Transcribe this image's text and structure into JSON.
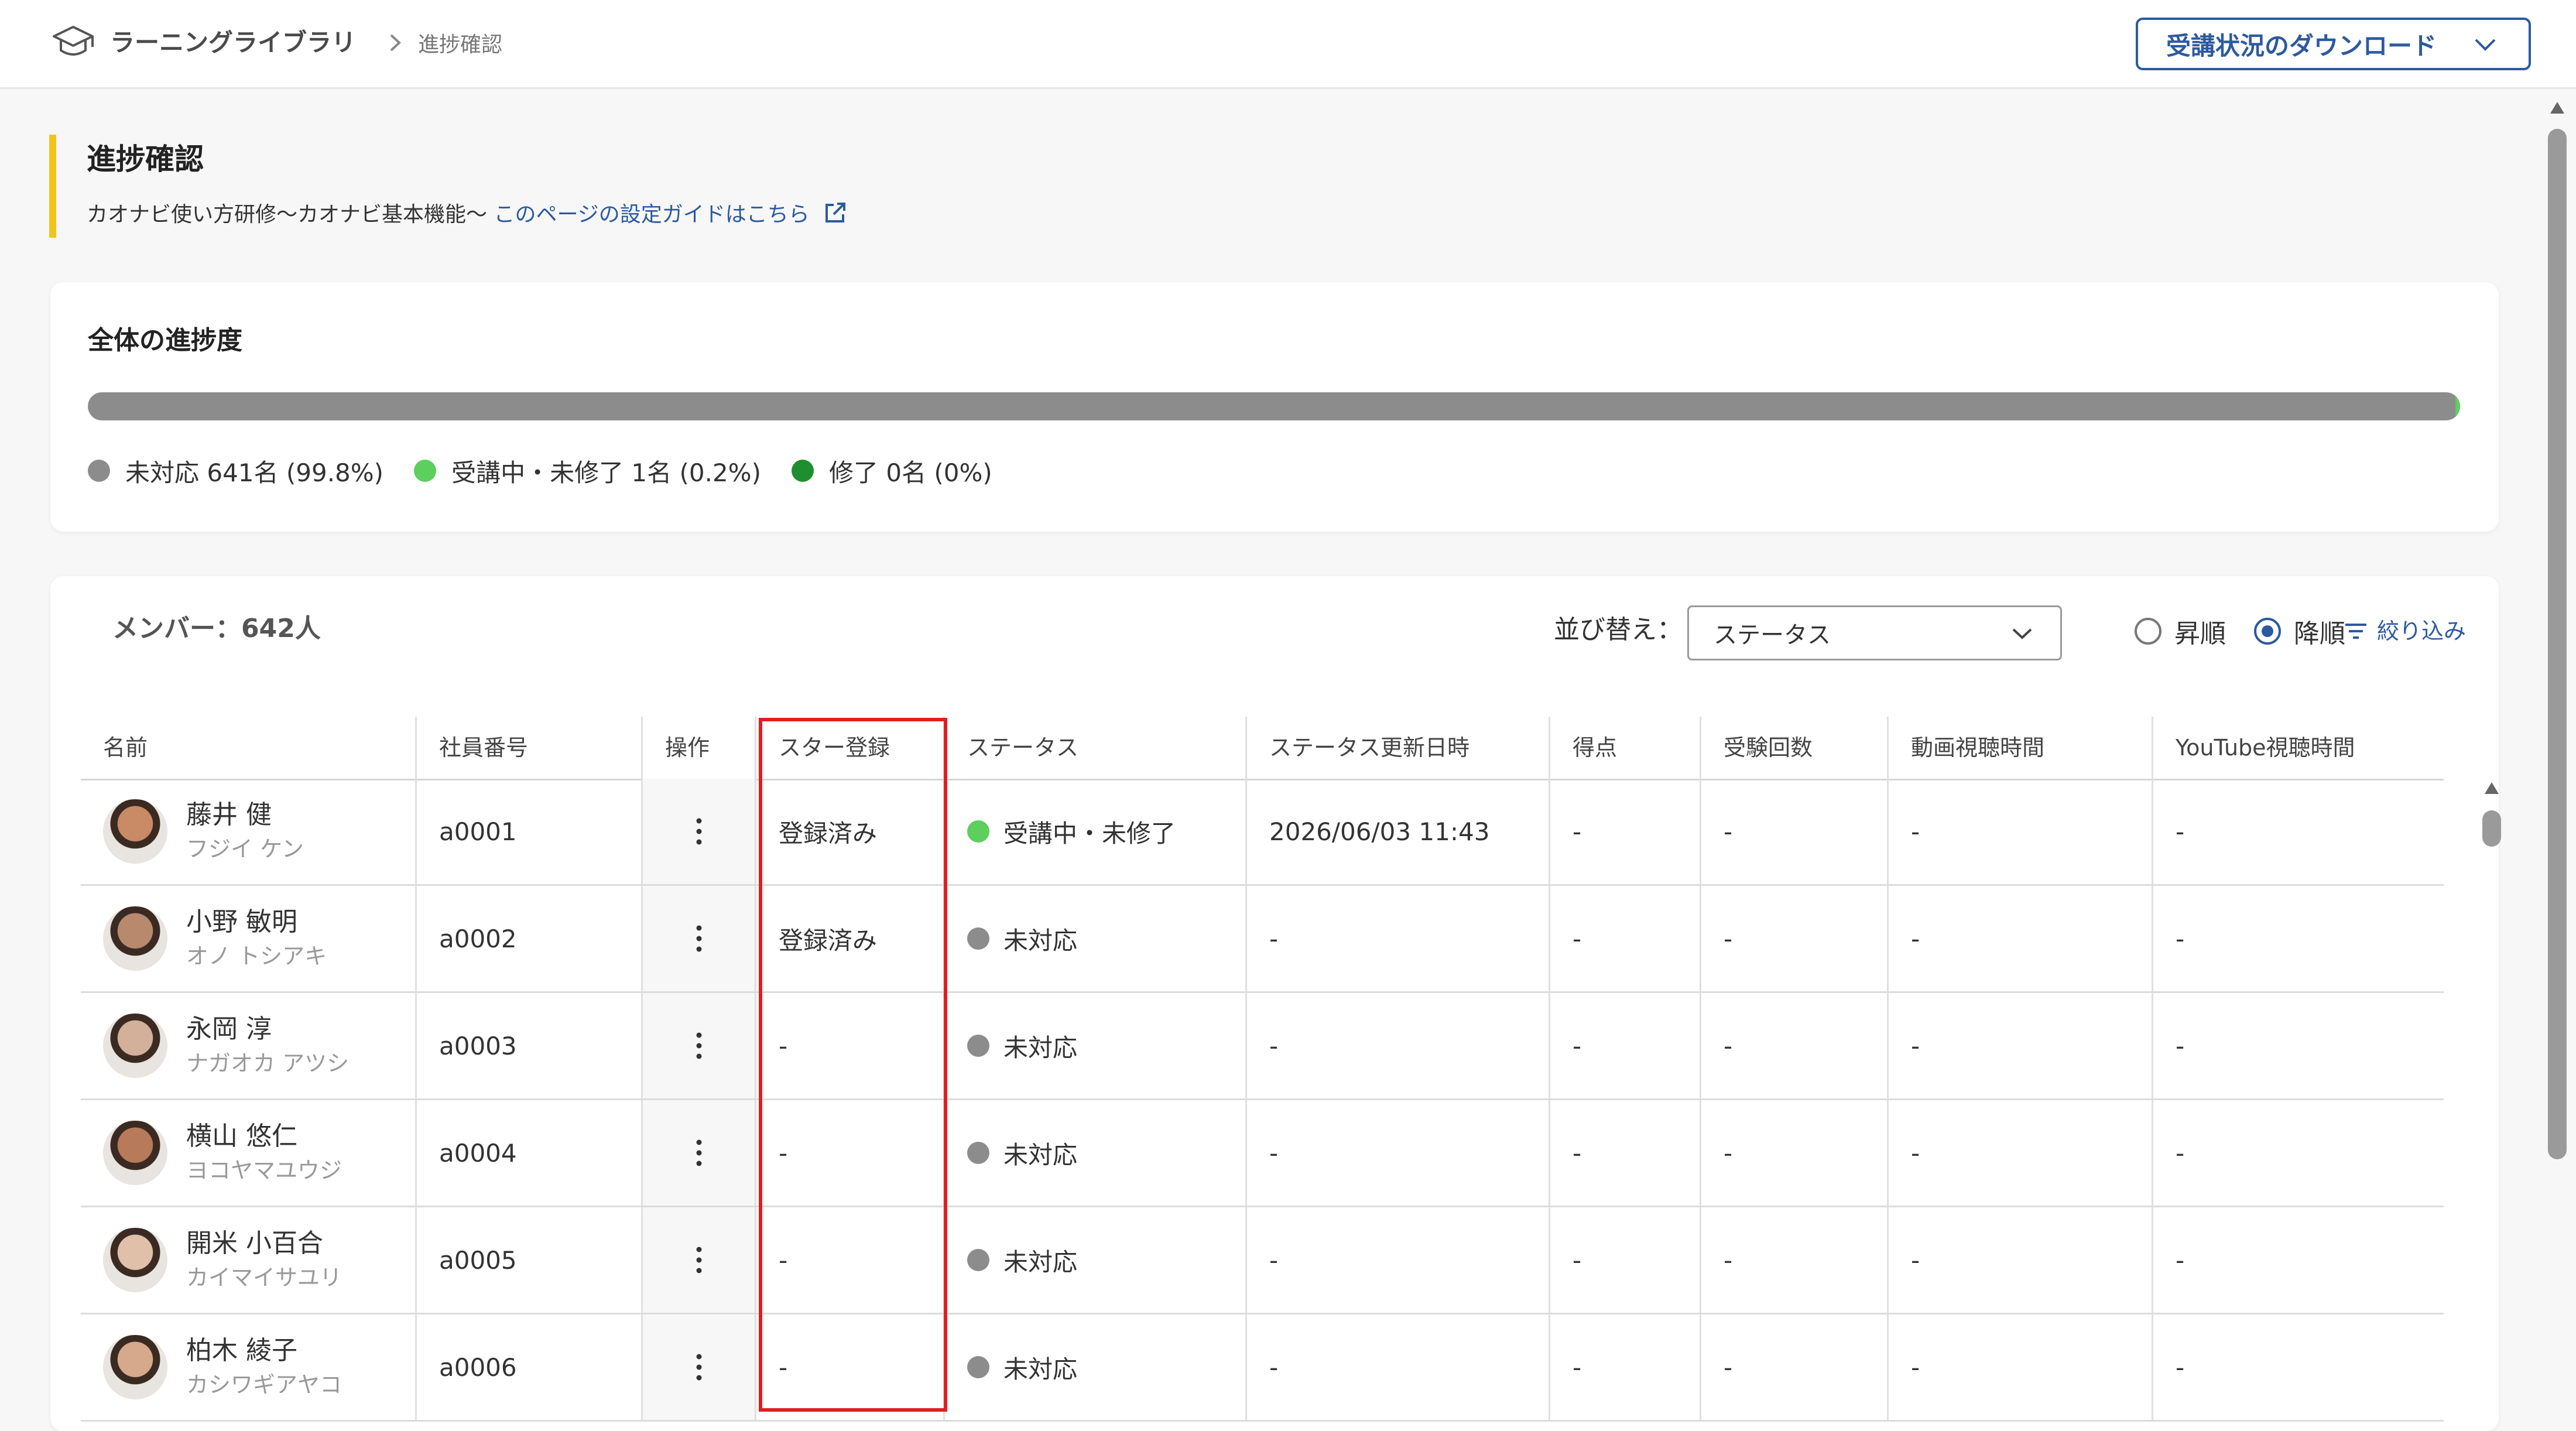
{
  "header": {
    "breadcrumb_root": "ラーニングライブラリ",
    "breadcrumb_current": "進捗確認",
    "download_button": "受講状況のダウンロード"
  },
  "page": {
    "title": "進捗確認",
    "course_name": "カオナビ使い方研修〜カオナビ基本機能〜",
    "guide_link": "このページの設定ガイドはこちら"
  },
  "progress": {
    "title": "全体の進捗度",
    "fractions": {
      "not_started": 0.998,
      "in_progress": 0.002,
      "completed": 0.0
    },
    "legend": [
      {
        "label": "未対応 641名 (99.8%)",
        "color": "#8c8c8c"
      },
      {
        "label": "受講中・未修了 1名 (0.2%)",
        "color": "#5ccf5c"
      },
      {
        "label": "修了 0名 (0%)",
        "color": "#1e8f2e"
      }
    ]
  },
  "members": {
    "count_label": "メンバー：642人",
    "sort_label": "並び替え：",
    "sort_value": "ステータス",
    "order_asc": "昇順",
    "order_desc": "降順",
    "order_selected": "desc",
    "filter_label": "絞り込み"
  },
  "table": {
    "columns": [
      "名前",
      "社員番号",
      "操作",
      "スター登録",
      "ステータス",
      "ステータス更新日時",
      "得点",
      "受験回数",
      "動画視聴時間",
      "YouTube視聴時間"
    ],
    "rows": [
      {
        "name": "藤井 健",
        "kana": "フジイ ケン",
        "id": "a0001",
        "star": "登録済み",
        "status": "受講中・未修了",
        "status_color": "#5ccf5c",
        "updated": "2026/06/03 11:43",
        "score": "-",
        "attempts": "-",
        "video": "-",
        "youtube": "-",
        "avatar_color": "#c98a66"
      },
      {
        "name": "小野 敏明",
        "kana": "オノ トシアキ",
        "id": "a0002",
        "star": "登録済み",
        "status": "未対応",
        "status_color": "#8c8c8c",
        "updated": "-",
        "score": "-",
        "attempts": "-",
        "video": "-",
        "youtube": "-",
        "avatar_color": "#b9896d"
      },
      {
        "name": "永岡 淳",
        "kana": "ナガオカ アツシ",
        "id": "a0003",
        "star": "-",
        "status": "未対応",
        "status_color": "#8c8c8c",
        "updated": "-",
        "score": "-",
        "attempts": "-",
        "video": "-",
        "youtube": "-",
        "avatar_color": "#d2b09a"
      },
      {
        "name": "横山 悠仁",
        "kana": "ヨコヤマユウジ",
        "id": "a0004",
        "star": "-",
        "status": "未対応",
        "status_color": "#8c8c8c",
        "updated": "-",
        "score": "-",
        "attempts": "-",
        "video": "-",
        "youtube": "-",
        "avatar_color": "#b77a5a"
      },
      {
        "name": "開米 小百合",
        "kana": "カイマイサユリ",
        "id": "a0005",
        "star": "-",
        "status": "未対応",
        "status_color": "#8c8c8c",
        "updated": "-",
        "score": "-",
        "attempts": "-",
        "video": "-",
        "youtube": "-",
        "avatar_color": "#e0c0a8"
      },
      {
        "name": "柏木 綾子",
        "kana": "カシワギアヤコ",
        "id": "a0006",
        "star": "-",
        "status": "未対応",
        "status_color": "#8c8c8c",
        "updated": "-",
        "score": "-",
        "attempts": "-",
        "video": "-",
        "youtube": "-",
        "avatar_color": "#d6a98c"
      }
    ]
  },
  "icons": {
    "brand": "graduation-cap-icon",
    "external": "external-link-icon",
    "filter": "filter-icon",
    "row_menu": "kebab-menu-icon"
  },
  "colors": {
    "accent": "#2c5aa0",
    "title_bar": "#f0c419",
    "highlight": "#e02020"
  }
}
